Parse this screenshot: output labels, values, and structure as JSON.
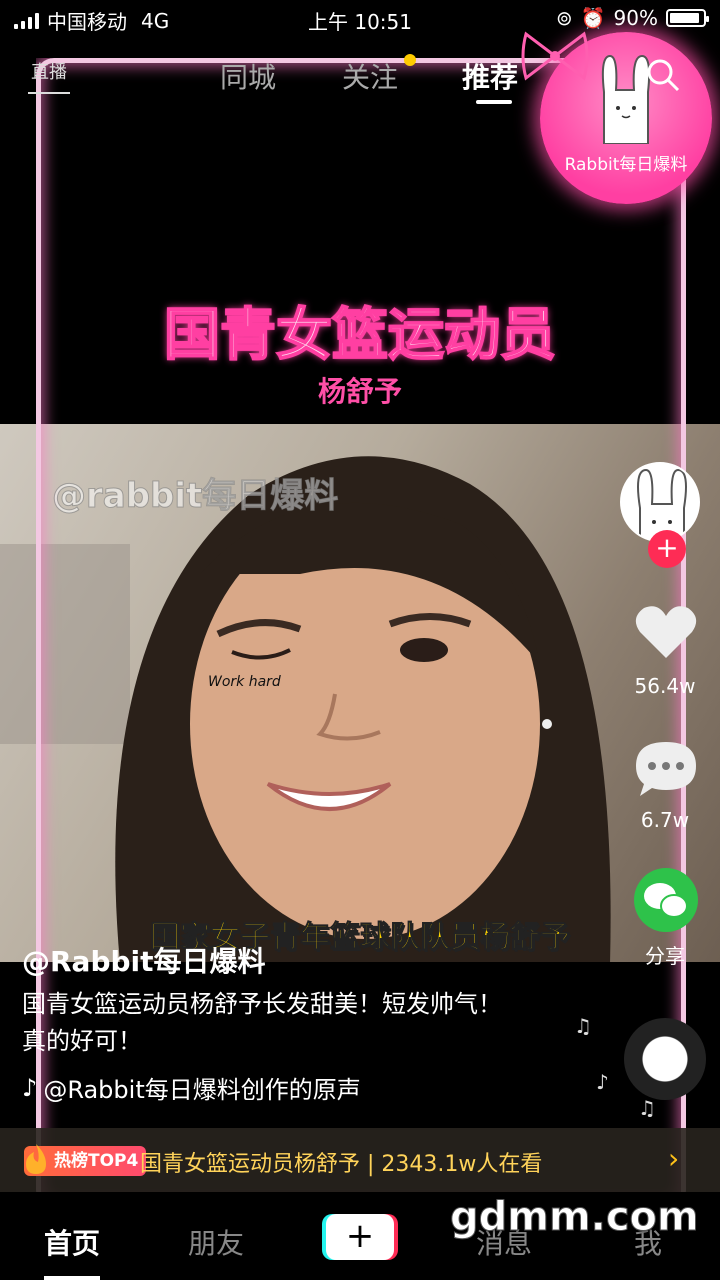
{
  "status_bar": {
    "carrier": "中国移动",
    "network": "4G",
    "time": "上午 10:51",
    "battery": "90%",
    "battery_level": 0.9
  },
  "top_nav": {
    "live": "直播",
    "tabs": [
      "同城",
      "关注",
      "推荐"
    ],
    "active_tab": "推荐"
  },
  "badge": {
    "label": "Rabbit每日爆料"
  },
  "overlay": {
    "title": "国青女篮运动员",
    "subtitle": "杨舒予"
  },
  "video": {
    "watermark": "@rabbit每日爆料",
    "caption": "国家女子青年篮球队队员杨舒予",
    "face_text": "Work hard"
  },
  "right_rail": {
    "likes": "56.4w",
    "comments": "6.7w",
    "share": "分享"
  },
  "post": {
    "author": "@Rabbit每日爆料",
    "description": "国青女篮运动员杨舒予长发甜美！短发帅气！真的好可！",
    "music": "@Rabbit每日爆料创作的原声"
  },
  "hot_banner": {
    "tag": "热榜TOP4",
    "text": "国青女篮运动员杨舒予 | 2343.1w人在看"
  },
  "tab_bar": {
    "items": [
      "首页",
      "朋友",
      "消息",
      "我"
    ],
    "plus": "+"
  },
  "site_watermark": "gdmm.com",
  "colors": {
    "neon_pink": "#ff3fa2",
    "like_red": "#fe2c55",
    "hot_yellow": "#ffd35a",
    "wechat_green": "#2ec24a"
  }
}
